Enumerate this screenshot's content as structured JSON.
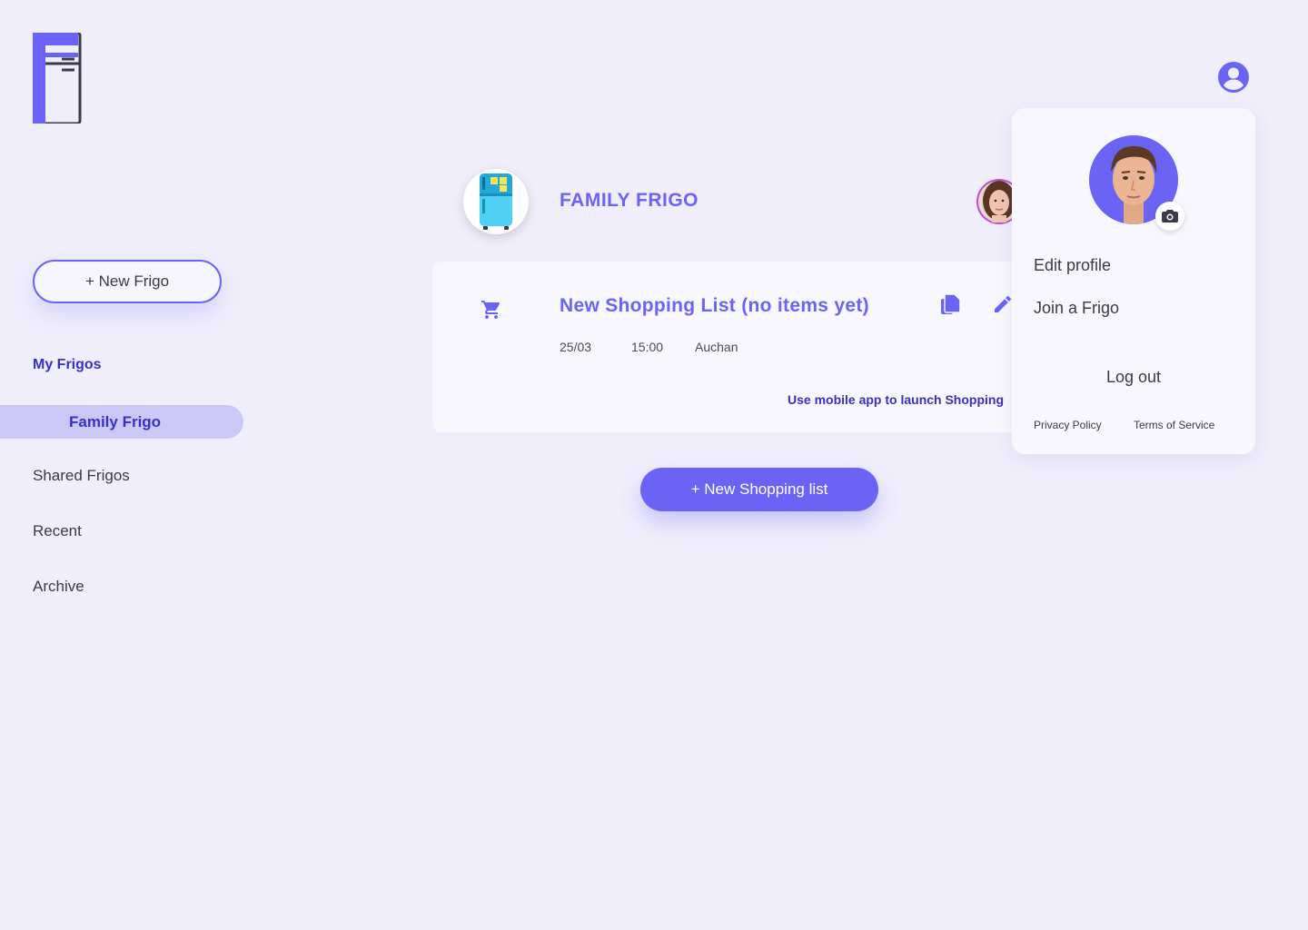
{
  "sidebar": {
    "new_frigo_label": "+ New Frigo",
    "section_title": "My Frigos",
    "items": [
      {
        "label": "Family Frigo",
        "active": true
      },
      {
        "label": "Shared Frigos"
      },
      {
        "label": "Recent"
      },
      {
        "label": "Archive"
      }
    ]
  },
  "frigo": {
    "title": "FAMILY FRIGO"
  },
  "shopping_list": {
    "title": "New Shopping List (no items yet)",
    "date": "25/03",
    "time": "15:00",
    "store": "Auchan",
    "launch_text": "Use mobile app to launch Shopping"
  },
  "new_list_label": "+ New Shopping list",
  "profile_menu": {
    "edit_profile": "Edit profile",
    "join_frigo": "Join a Frigo",
    "log_out": "Log out",
    "privacy": "Privacy Policy",
    "terms": "Terms of Service"
  },
  "colors": {
    "accent": "#6b63f6",
    "accent_dark": "#3a2fc4",
    "background": "#f0eefb",
    "active_nav": "#cbc8f7"
  },
  "icons": [
    "fridge-logo",
    "cart-icon",
    "copy-icon",
    "pencil-icon",
    "user-circle-icon",
    "camera-icon"
  ]
}
